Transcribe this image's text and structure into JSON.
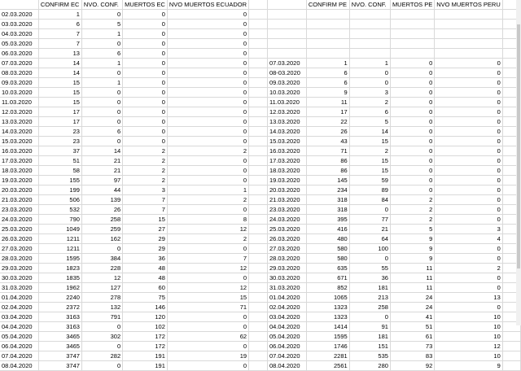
{
  "headers": {
    "ec": [
      "",
      "CONFIRM EC",
      "NVO. CONF.",
      "MUERTOS EC",
      "NVO MUERTOS ECUADOR"
    ],
    "pe": [
      "",
      "CONFIRM PE",
      "NVO. CONF.",
      "MUERTOS PE",
      "NVO MUERTOS PERU"
    ]
  },
  "ecuador": [
    [
      "02.03.2020",
      "1",
      "0",
      "0",
      "0"
    ],
    [
      "03.03.2020",
      "6",
      "5",
      "0",
      "0"
    ],
    [
      "04.03.2020",
      "7",
      "1",
      "0",
      "0"
    ],
    [
      "05.03.2020",
      "7",
      "0",
      "0",
      "0"
    ],
    [
      "06.03.2020",
      "13",
      "6",
      "0",
      "0"
    ],
    [
      "07.03.2020",
      "14",
      "1",
      "0",
      "0"
    ],
    [
      "08.03.2020",
      "14",
      "0",
      "0",
      "0"
    ],
    [
      "09.03.2020",
      "15",
      "1",
      "0",
      "0"
    ],
    [
      "10.03.2020",
      "15",
      "0",
      "0",
      "0"
    ],
    [
      "11.03.2020",
      "15",
      "0",
      "0",
      "0"
    ],
    [
      "12.03.2020",
      "17",
      "0",
      "0",
      "0"
    ],
    [
      "13.03.2020",
      "17",
      "0",
      "0",
      "0"
    ],
    [
      "14.03.2020",
      "23",
      "6",
      "0",
      "0"
    ],
    [
      "15.03.2020",
      "23",
      "0",
      "0",
      "0"
    ],
    [
      "16.03.2020",
      "37",
      "14",
      "2",
      "2"
    ],
    [
      "17.03.2020",
      "51",
      "21",
      "2",
      "0"
    ],
    [
      "18.03.2020",
      "58",
      "21",
      "2",
      "0"
    ],
    [
      "19.03.2020",
      "155",
      "97",
      "2",
      "0"
    ],
    [
      "20.03.2020",
      "199",
      "44",
      "3",
      "1"
    ],
    [
      "21.03.2020",
      "506",
      "139",
      "7",
      "2"
    ],
    [
      "23.03.2020",
      "532",
      "26",
      "7",
      "0"
    ],
    [
      "24.03.2020",
      "790",
      "258",
      "15",
      "8"
    ],
    [
      "25.03.2020",
      "1049",
      "259",
      "27",
      "12"
    ],
    [
      "26.03.2020",
      "1211",
      "162",
      "29",
      "2"
    ],
    [
      "27.03.2020",
      "1211",
      "0",
      "29",
      "0"
    ],
    [
      "28.03.2020",
      "1595",
      "384",
      "36",
      "7"
    ],
    [
      "29.03.2020",
      "1823",
      "228",
      "48",
      "12"
    ],
    [
      "30.03.2020",
      "1835",
      "12",
      "48",
      "0"
    ],
    [
      "31.03.2020",
      "1962",
      "127",
      "60",
      "12"
    ],
    [
      "01.04.2020",
      "2240",
      "278",
      "75",
      "15"
    ],
    [
      "02.04.2020",
      "2372",
      "132",
      "146",
      "71"
    ],
    [
      "03.04.2020",
      "3163",
      "791",
      "120",
      "0"
    ],
    [
      "04.04.2020",
      "3163",
      "0",
      "102",
      "0"
    ],
    [
      "05.04.2020",
      "3465",
      "302",
      "172",
      "62"
    ],
    [
      "06.04.2020",
      "3465",
      "0",
      "172",
      "0"
    ],
    [
      "07.04.2020",
      "3747",
      "282",
      "191",
      "19"
    ],
    [
      "08.04.2020",
      "3747",
      "0",
      "191",
      "0"
    ]
  ],
  "peru": [
    [
      "",
      "",
      "",
      "",
      ""
    ],
    [
      "",
      "",
      "",
      "",
      ""
    ],
    [
      "",
      "",
      "",
      "",
      ""
    ],
    [
      "",
      "",
      "",
      "",
      ""
    ],
    [
      "",
      "",
      "",
      "",
      ""
    ],
    [
      "07.03.2020",
      "1",
      "1",
      "0",
      "0"
    ],
    [
      "08-03.2020",
      "6",
      "0",
      "0",
      "0"
    ],
    [
      "09.03.2020",
      "6",
      "0",
      "0",
      "0"
    ],
    [
      "10.03.2020",
      "9",
      "3",
      "0",
      "0"
    ],
    [
      "11.03.2020",
      "11",
      "2",
      "0",
      "0"
    ],
    [
      "12.03.2020",
      "17",
      "6",
      "0",
      "0"
    ],
    [
      "13.03.2020",
      "22",
      "5",
      "0",
      "0"
    ],
    [
      "14.03.2020",
      "26",
      "14",
      "0",
      "0"
    ],
    [
      "15.03.2020",
      "43",
      "15",
      "0",
      "0"
    ],
    [
      "16.03.2020",
      "71",
      "2",
      "0",
      "0"
    ],
    [
      "17.03.2020",
      "86",
      "15",
      "0",
      "0"
    ],
    [
      "18.03.2020",
      "86",
      "15",
      "0",
      "0"
    ],
    [
      "19.03.2020",
      "145",
      "59",
      "0",
      "0"
    ],
    [
      "20.03.2020",
      "234",
      "89",
      "0",
      "0"
    ],
    [
      "21.03.2020",
      "318",
      "84",
      "2",
      "0"
    ],
    [
      "23.03.2020",
      "318",
      "0",
      "2",
      "0"
    ],
    [
      "24.03.2020",
      "395",
      "77",
      "2",
      "0"
    ],
    [
      "25.03.2020",
      "416",
      "21",
      "5",
      "3"
    ],
    [
      "26.03.2020",
      "480",
      "64",
      "9",
      "4"
    ],
    [
      "27.03.2020",
      "580",
      "100",
      "9",
      "0"
    ],
    [
      "28.03.2020",
      "580",
      "0",
      "9",
      "0"
    ],
    [
      "29.03.2020",
      "635",
      "55",
      "11",
      "2"
    ],
    [
      "30.03.2020",
      "671",
      "36",
      "11",
      "0"
    ],
    [
      "31.03.2020",
      "852",
      "181",
      "11",
      "0"
    ],
    [
      "01.04.2020",
      "1065",
      "213",
      "24",
      "13"
    ],
    [
      "02.04.2020",
      "1323",
      "258",
      "24",
      "0"
    ],
    [
      "03.04.2020",
      "1323",
      "0",
      "41",
      "10"
    ],
    [
      "04.04.2020",
      "1414",
      "91",
      "51",
      "10"
    ],
    [
      "05.04.2020",
      "1595",
      "181",
      "61",
      "10"
    ],
    [
      "06.04.2020",
      "1746",
      "151",
      "73",
      "12"
    ],
    [
      "07.04.2020",
      "2281",
      "535",
      "83",
      "10"
    ],
    [
      "08.04.2020",
      "2561",
      "280",
      "92",
      "9"
    ]
  ]
}
